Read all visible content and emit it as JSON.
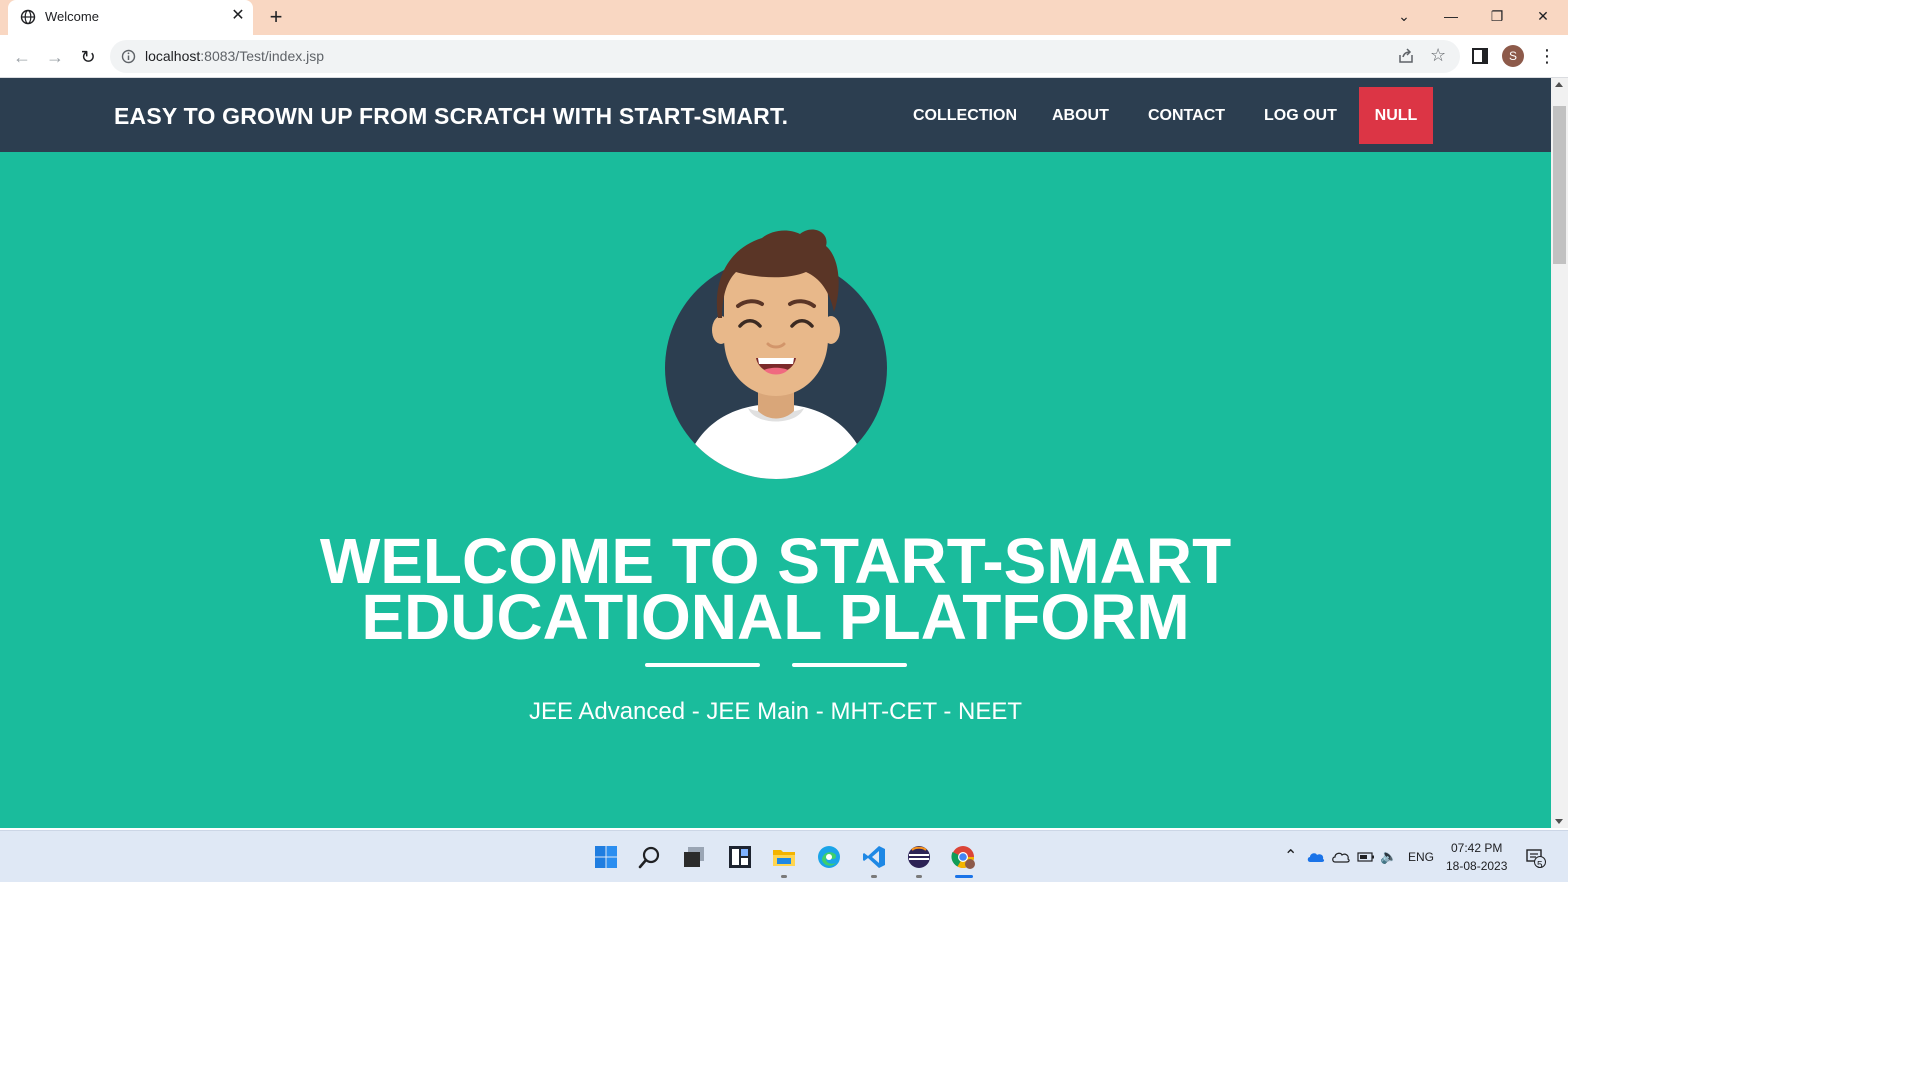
{
  "browser": {
    "tab_title": "Welcome",
    "url_host": "localhost",
    "url_rest": ":8083/Test/index.jsp",
    "profile_initial": "S"
  },
  "navbar": {
    "brand": "EASY TO GROWN UP FROM SCRATCH WITH START-SMART.",
    "links": [
      "COLLECTION",
      "ABOUT",
      "CONTACT",
      "LOG OUT"
    ],
    "user_button": "NULL"
  },
  "hero": {
    "title_line1": "WELCOME TO START-SMART",
    "title_line2": "EDUCATIONAL PLATFORM",
    "subtitle": "JEE Advanced - JEE Main - MHT-CET - NEET"
  },
  "taskbar": {
    "language": "ENG",
    "time": "07:42 PM",
    "date": "18-08-2023",
    "notification_count": "5"
  },
  "colors": {
    "page_bg": "#1abc9c",
    "navbar_bg": "#2c3e50",
    "accent_button": "#dc3545",
    "titlebar": "#f9d7c2"
  }
}
